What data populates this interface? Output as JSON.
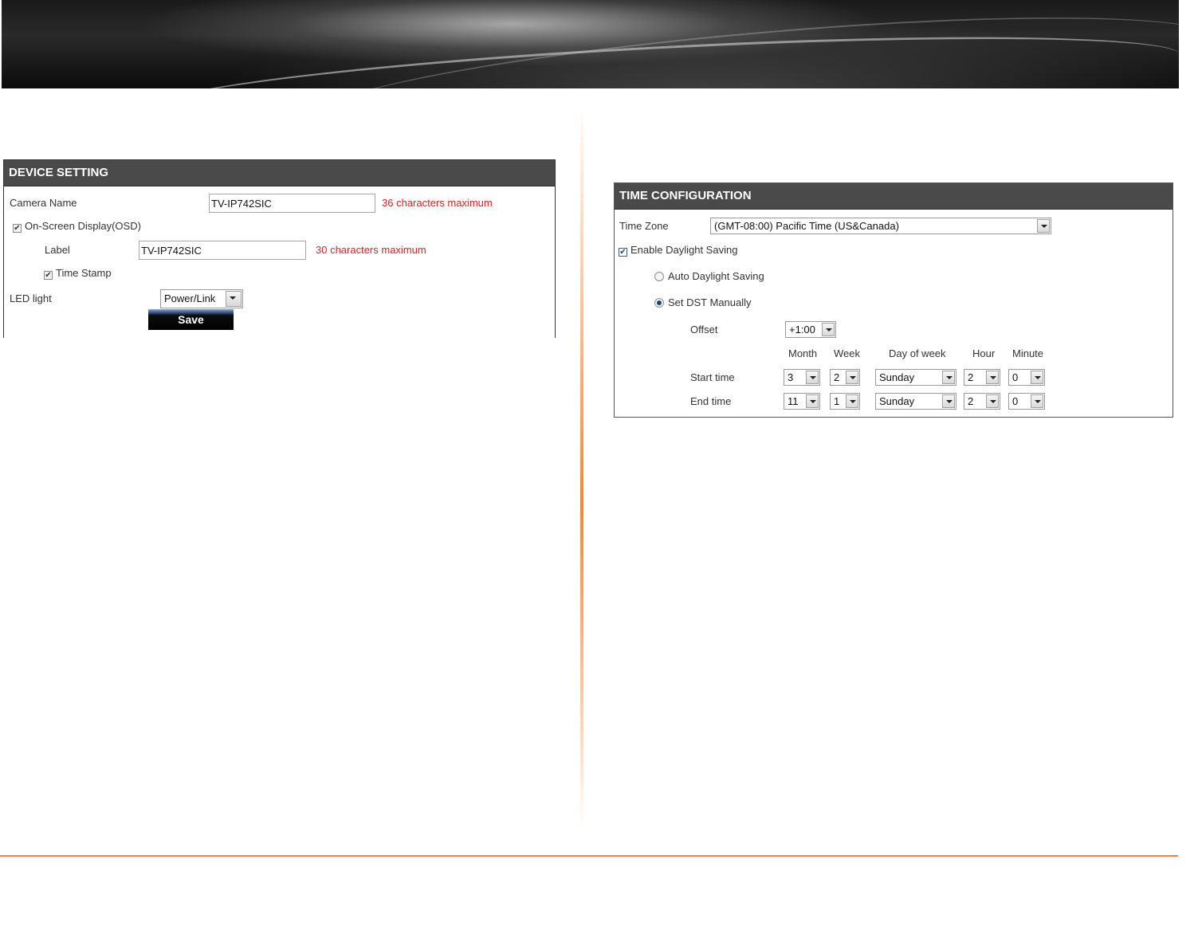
{
  "device_setting": {
    "title": "DEVICE SETTING",
    "camera_name_label": "Camera Name",
    "camera_name_value": "TV-IP742SIC",
    "camera_name_hint": "36 characters maximum",
    "osd_label": "On-Screen Display(OSD)",
    "osd_checked": true,
    "label_label": "Label",
    "label_value": "TV-IP742SIC",
    "label_hint": "30 characters maximum",
    "time_stamp_label": "Time Stamp",
    "time_stamp_checked": true,
    "led_light_label": "LED light",
    "led_light_value": "Power/Link",
    "save_label": "Save"
  },
  "time_configuration": {
    "title": "TIME CONFIGURATION",
    "time_zone_label": "Time Zone",
    "time_zone_value": "(GMT-08:00) Pacific Time (US&Canada)",
    "enable_dst_label": "Enable Daylight Saving",
    "enable_dst_checked": true,
    "auto_dst_label": "Auto Daylight Saving",
    "manual_dst_label": "Set DST Manually",
    "offset_label": "Offset",
    "offset_value": "+1:00",
    "columns": {
      "month": "Month",
      "week": "Week",
      "day_of_week": "Day of week",
      "hour": "Hour",
      "minute": "Minute"
    },
    "start_time": {
      "label": "Start time",
      "month": "3",
      "week": "2",
      "day": "Sunday",
      "hour": "2",
      "minute": "0"
    },
    "end_time": {
      "label": "End time",
      "month": "11",
      "week": "1",
      "day": "Sunday",
      "hour": "2",
      "minute": "0"
    }
  },
  "colors": {
    "panel_header": "#4a4a4a",
    "hint_red": "#e02020",
    "accent_orange": "#e8834a"
  }
}
